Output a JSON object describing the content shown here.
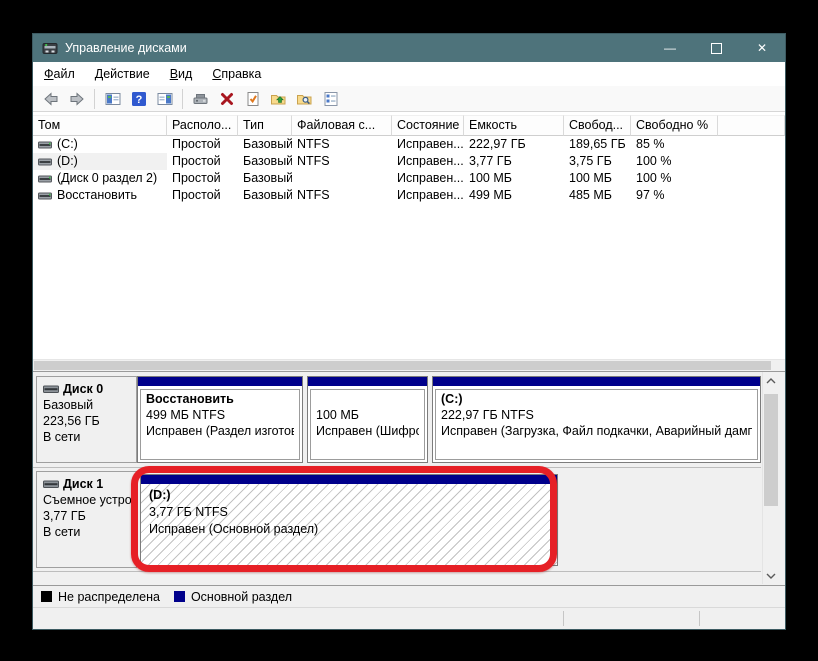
{
  "window": {
    "title": "Управление дисками",
    "controls": {
      "minimize": "—",
      "close": "✕"
    }
  },
  "menubar": {
    "items": [
      {
        "accel": "Ф",
        "rest": "айл"
      },
      {
        "accel": "Д",
        "rest": "ействие"
      },
      {
        "accel": "В",
        "rest": "ид"
      },
      {
        "accel": "С",
        "rest": "правка"
      }
    ]
  },
  "toolbar": {
    "icons": [
      "back-icon",
      "forward-icon",
      "show-console-tree-icon",
      "help-icon",
      "show-action-pane-icon",
      "device-icon",
      "delete-icon",
      "properties-check-icon",
      "folder-up-icon",
      "folder-explore-icon",
      "task-list-icon"
    ]
  },
  "volume_list": {
    "columns": [
      "Том",
      "Располо...",
      "Тип",
      "Файловая с...",
      "Состояние",
      "Емкость",
      "Свобод...",
      "Свободно %"
    ],
    "rows": [
      {
        "name": "(C:)",
        "layout": "Простой",
        "type": "Базовый",
        "fs": "NTFS",
        "status": "Исправен...",
        "capacity": "222,97 ГБ",
        "free": "189,65 ГБ",
        "free_pct": "85 %"
      },
      {
        "name": "(D:)",
        "layout": "Простой",
        "type": "Базовый",
        "fs": "NTFS",
        "status": "Исправен...",
        "capacity": "3,77 ГБ",
        "free": "3,75 ГБ",
        "free_pct": "100 %"
      },
      {
        "name": "(Диск 0 раздел 2)",
        "layout": "Простой",
        "type": "Базовый",
        "fs": "",
        "status": "Исправен...",
        "capacity": "100 МБ",
        "free": "100 МБ",
        "free_pct": "100 %"
      },
      {
        "name": "Восстановить",
        "layout": "Простой",
        "type": "Базовый",
        "fs": "NTFS",
        "status": "Исправен...",
        "capacity": "499 МБ",
        "free": "485 МБ",
        "free_pct": "97 %"
      }
    ]
  },
  "disks": [
    {
      "name": "Диск 0",
      "type": "Базовый",
      "size": "223,56 ГБ",
      "status": "В сети",
      "partitions": [
        {
          "title": "Восстановить",
          "size_line": "499 МБ NTFS",
          "status_line": "Исправен (Раздел изготовителя ОЭМ)"
        },
        {
          "title": "",
          "size_line": "100 МБ",
          "status_line": "Исправен (Шифрованный (EFI) системный раздел)"
        },
        {
          "title": "(C:)",
          "size_line": "222,97 ГБ NTFS",
          "status_line": "Исправен (Загрузка, Файл подкачки, Аварийный дамп памяти, Основной раздел)"
        }
      ]
    },
    {
      "name": "Диск 1",
      "type": "Съемное устройство",
      "size": "3,77 ГБ",
      "status": "В сети",
      "partitions": [
        {
          "title": "(D:)",
          "size_line": "3,77 ГБ NTFS",
          "status_line": "Исправен (Основной раздел)"
        }
      ]
    }
  ],
  "legend": {
    "items": [
      {
        "label": "Не распределена",
        "color": "#000000"
      },
      {
        "label": "Основной раздел",
        "color": "#00008b"
      }
    ]
  },
  "colors": {
    "titlebar": "#4e737b",
    "partition_bar": "#00008b",
    "annotation_red": "#e62026",
    "panel_gray": "#f0f0f0"
  }
}
